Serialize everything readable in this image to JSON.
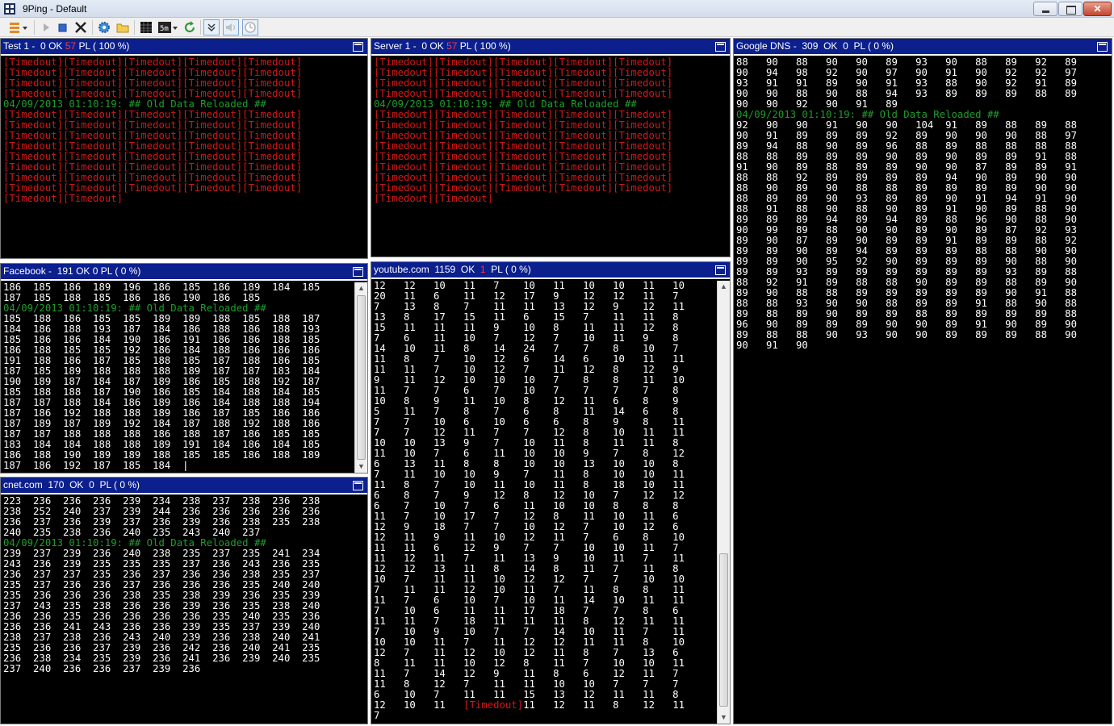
{
  "window": {
    "title": "9Ping - Default"
  },
  "toolbar": {
    "buttons": [
      "menu-icon",
      "play-icon",
      "stop-icon",
      "delete-icon",
      "settings-icon",
      "folder-icon",
      "grid-icon",
      "interval-icon",
      "refresh-icon",
      "collapse-icon",
      "sound-icon",
      "clock-icon"
    ]
  },
  "colors": {
    "panel_header": "#0b1f8d",
    "ok_text": "#ffffff",
    "timeout": "#d01818",
    "reloaded": "#1e9c2c",
    "background": "#000000"
  },
  "panels": {
    "test1": {
      "name": "Test 1 -",
      "ok_count": "0",
      "ok_label": "OK",
      "fail_count": "57",
      "pl_label": "PL ( 100 %)",
      "lines": [
        {
          "type": "to",
          "text": "[Timedout][Timedout][Timedout][Timedout][Timedout]"
        },
        {
          "type": "to",
          "text": "[Timedout][Timedout][Timedout][Timedout][Timedout]"
        },
        {
          "type": "to",
          "text": "[Timedout][Timedout][Timedout][Timedout][Timedout]"
        },
        {
          "type": "to",
          "text": "[Timedout][Timedout][Timedout][Timedout][Timedout]"
        },
        {
          "type": "green",
          "text": "04/09/2013 01:10:19: ## Old Data Reloaded ##"
        },
        {
          "type": "to",
          "text": "[Timedout][Timedout][Timedout][Timedout][Timedout]"
        },
        {
          "type": "to",
          "text": "[Timedout][Timedout][Timedout][Timedout][Timedout]"
        },
        {
          "type": "to",
          "text": "[Timedout][Timedout][Timedout][Timedout][Timedout]"
        },
        {
          "type": "to",
          "text": "[Timedout][Timedout][Timedout][Timedout][Timedout]"
        },
        {
          "type": "to",
          "text": "[Timedout][Timedout][Timedout][Timedout][Timedout]"
        },
        {
          "type": "to",
          "text": "[Timedout][Timedout][Timedout][Timedout][Timedout]"
        },
        {
          "type": "to",
          "text": "[Timedout][Timedout][Timedout][Timedout][Timedout]"
        },
        {
          "type": "to",
          "text": "[Timedout][Timedout][Timedout][Timedout][Timedout]"
        },
        {
          "type": "to",
          "text": "[Timedout][Timedout]"
        }
      ]
    },
    "server1": {
      "name": "Server 1 -",
      "ok_count": "0",
      "ok_label": "OK",
      "fail_count": "57",
      "pl_label": "PL ( 100 %)",
      "lines": [
        {
          "type": "to",
          "text": "[Timedout][Timedout][Timedout][Timedout][Timedout]"
        },
        {
          "type": "to",
          "text": "[Timedout][Timedout][Timedout][Timedout][Timedout]"
        },
        {
          "type": "to",
          "text": "[Timedout][Timedout][Timedout][Timedout][Timedout]"
        },
        {
          "type": "to",
          "text": "[Timedout][Timedout][Timedout][Timedout][Timedout]"
        },
        {
          "type": "green",
          "text": "04/09/2013 01:10:19: ## Old Data Reloaded ##"
        },
        {
          "type": "to",
          "text": "[Timedout][Timedout][Timedout][Timedout][Timedout]"
        },
        {
          "type": "to",
          "text": "[Timedout][Timedout][Timedout][Timedout][Timedout]"
        },
        {
          "type": "to",
          "text": "[Timedout][Timedout][Timedout][Timedout][Timedout]"
        },
        {
          "type": "to",
          "text": "[Timedout][Timedout][Timedout][Timedout][Timedout]"
        },
        {
          "type": "to",
          "text": "[Timedout][Timedout][Timedout][Timedout][Timedout]"
        },
        {
          "type": "to",
          "text": "[Timedout][Timedout][Timedout][Timedout][Timedout]"
        },
        {
          "type": "to",
          "text": "[Timedout][Timedout][Timedout][Timedout][Timedout]"
        },
        {
          "type": "to",
          "text": "[Timedout][Timedout][Timedout][Timedout][Timedout]"
        },
        {
          "type": "to",
          "text": "[Timedout][Timedout]"
        }
      ]
    },
    "google": {
      "name": "Google DNS -",
      "ok_count": "309",
      "ok_label": "OK",
      "fail_count": "0",
      "pl_label": "PL ( 0 %)",
      "lines": [
        {
          "type": "num",
          "text": "88   90   88   90   90   89   93   90   88   89   92   89"
        },
        {
          "type": "num",
          "text": "90   94   98   92   90   97   90   91   90   92   92   97"
        },
        {
          "type": "num",
          "text": "93   91   91   89   90   91   93   88   90   92   91   89"
        },
        {
          "type": "num",
          "text": "90   90   88   90   88   94   93   89   89   89   88   89"
        },
        {
          "type": "num",
          "text": "90   90   92   90   91   89"
        },
        {
          "type": "green",
          "text": "04/09/2013 01:10:19: ## Old Data Reloaded ##"
        },
        {
          "type": "num",
          "text": "92   90   90   91   90   90   104  91   89   88   89   88"
        },
        {
          "type": "num",
          "text": "90   91   89   89   89   92   89   90   90   90   88   97"
        },
        {
          "type": "num",
          "text": "89   94   88   90   89   96   88   89   88   88   88   88"
        },
        {
          "type": "num",
          "text": "88   88   89   89   89   90   89   90   89   89   91   88"
        },
        {
          "type": "num",
          "text": "91   90   89   88   89   89   90   90   87   89   89   91"
        },
        {
          "type": "num",
          "text": "88   88   92   89   89   89   89   94   90   89   90   90"
        },
        {
          "type": "num",
          "text": "88   90   89   90   88   88   89   89   89   89   90   90"
        },
        {
          "type": "num",
          "text": "88   89   89   90   93   89   89   90   91   94   91   90"
        },
        {
          "type": "num",
          "text": "88   91   88   90   88   90   89   91   90   89   88   90"
        },
        {
          "type": "num",
          "text": "89   89   89   94   89   94   89   88   96   90   88   90"
        },
        {
          "type": "num",
          "text": "90   99   89   88   90   90   89   90   89   87   92   93"
        },
        {
          "type": "num",
          "text": "89   90   87   89   90   89   89   91   89   89   88   92"
        },
        {
          "type": "num",
          "text": "89   89   90   89   94   89   89   89   88   88   90   90"
        },
        {
          "type": "num",
          "text": "89   89   90   95   92   90   89   89   89   90   88   90"
        },
        {
          "type": "num",
          "text": "89   89   93   89   89   89   89   89   89   93   89   88"
        },
        {
          "type": "num",
          "text": "88   92   91   89   88   88   90   89   89   88   89   90"
        },
        {
          "type": "num",
          "text": "89   90   88   88   89   89   89   89   89   90   91   88"
        },
        {
          "type": "num",
          "text": "88   88   93   90   90   88   89   89   91   88   90   88"
        },
        {
          "type": "num",
          "text": "89   88   89   90   89   89   88   89   89   89   89   88"
        },
        {
          "type": "num",
          "text": "96   90   89   89   89   90   90   89   91   90   89   90"
        },
        {
          "type": "num",
          "text": "89   88   88   90   93   90   90   89   89   89   88   90"
        },
        {
          "type": "num",
          "text": "90   91   90"
        }
      ]
    },
    "facebook": {
      "name": "Facebook -",
      "ok_count": "191",
      "ok_label": "OK",
      "fail_count": "0",
      "pl_label": "PL ( 0 %)",
      "lines": [
        {
          "type": "num",
          "text": "186  185  186  189  196  186  185  186  189  184  185"
        },
        {
          "type": "num",
          "text": "187  185  188  185  186  186  190  186  185"
        },
        {
          "type": "green",
          "text": "04/09/2013 01:10:19: ## Old Data Reloaded ##"
        },
        {
          "type": "num",
          "text": "185  188  186  185  185  189  189  188  185  188  187"
        },
        {
          "type": "num",
          "text": "184  186  188  193  187  184  186  188  186  188  193"
        },
        {
          "type": "num",
          "text": "185  186  186  184  190  186  191  186  186  188  185"
        },
        {
          "type": "num",
          "text": "186  188  185  185  192  186  184  188  186  186  186"
        },
        {
          "type": "num",
          "text": "191  188  186  187  185  188  185  187  188  186  185"
        },
        {
          "type": "num",
          "text": "187  185  189  188  188  188  189  187  187  183  184"
        },
        {
          "type": "num",
          "text": "190  189  187  184  187  189  186  185  188  192  187"
        },
        {
          "type": "num",
          "text": "185  188  188  187  190  186  185  184  188  184  185"
        },
        {
          "type": "num",
          "text": "187  187  188  184  186  189  186  184  188  188  194"
        },
        {
          "type": "num",
          "text": "187  186  192  188  188  189  186  187  185  186  186"
        },
        {
          "type": "num",
          "text": "187  189  187  189  192  184  187  188  192  188  186"
        },
        {
          "type": "num",
          "text": "187  187  188  188  188  186  188  187  186  185  185"
        },
        {
          "type": "num",
          "text": "183  184  184  188  188  189  191  184  186  184  185"
        },
        {
          "type": "num",
          "text": "186  188  190  189  189  188  185  185  186  188  189"
        },
        {
          "type": "num",
          "text": "187  186  192  187  185  184  |"
        }
      ]
    },
    "youtube": {
      "name": "youtube.com",
      "ok_count": "1159",
      "ok_label": "OK",
      "fail_count": "1",
      "pl_label": "PL ( 0 %)",
      "lines": [
        {
          "type": "num",
          "text": "12   12   10   11   7    10   11   10   10   11   10"
        },
        {
          "type": "num",
          "text": "20   11   6    11   12   17   9    12   12   11   7"
        },
        {
          "type": "num",
          "text": "7    13   8    7    11   11   13   12   9    12   11"
        },
        {
          "type": "num",
          "text": "13   8    17   15   11   6    15   7    11   11   8"
        },
        {
          "type": "num",
          "text": "15   11   11   11   9    10   8    11   11   12   8"
        },
        {
          "type": "num",
          "text": "7    6    11   10   7    12   7    10   11   9    8"
        },
        {
          "type": "num",
          "text": "14   10   11   8    14   24   7    7    8    10   7"
        },
        {
          "type": "num",
          "text": "11   8    7    10   12   6    14   6    10   11   11"
        },
        {
          "type": "num",
          "text": "11   11   7    10   12   7    11   12   8    12   9"
        },
        {
          "type": "num",
          "text": "9    11   12   10   10   10   7    8    8    11   10"
        },
        {
          "type": "num",
          "text": "11   7    7    6    7    10   7    7    7    7    8"
        },
        {
          "type": "num",
          "text": "10   8    9    11   10   8    12   11   6    8    9"
        },
        {
          "type": "num",
          "text": "5    11   7    8    7    6    8    11   14   6    8"
        },
        {
          "type": "num",
          "text": "7    7    10   6    10   6    6    8    9    8    11"
        },
        {
          "type": "num",
          "text": "7    7    12   11   7    7    12   8    10   11   11"
        },
        {
          "type": "num",
          "text": "10   10   13   9    7    10   11   8    11   11   8"
        },
        {
          "type": "num",
          "text": "11   10   7    6    11   10   10   9    7    8    12"
        },
        {
          "type": "num",
          "text": "6    13   11   8    8    10   10   13   10   10   8"
        },
        {
          "type": "num",
          "text": "7    11   10   10   9    7    11   8    10   10   11"
        },
        {
          "type": "num",
          "text": "11   8    7    10   11   10   11   8    18   10   11"
        },
        {
          "type": "num",
          "text": "6    8    7    9    12   8    12   10   7    12   12"
        },
        {
          "type": "num",
          "text": "6    7    10   7    6    11   10   10   8    8    8"
        },
        {
          "type": "num",
          "text": "11   7    10   17   7    12   8    11   10   11   6"
        },
        {
          "type": "num",
          "text": "12   9    18   7    7    10   12   7    10   12   6"
        },
        {
          "type": "num",
          "text": "12   11   9    11   10   12   11   7    6    8    10"
        },
        {
          "type": "num",
          "text": "11   11   6    12   9    7    7    10   10   11   7"
        },
        {
          "type": "num",
          "text": "11   12   11   7    11   13   9    10   11   7    11"
        },
        {
          "type": "num",
          "text": "12   12   13   11   8    14   8    11   7    11   8"
        },
        {
          "type": "num",
          "text": "10   7    11   11   10   12   12   7    7    10   10"
        },
        {
          "type": "num",
          "text": "7    11   11   12   10   11   7    11   8    8    11"
        },
        {
          "type": "num",
          "text": "11   7    6    10   7    10   11   14   10   11   11"
        },
        {
          "type": "num",
          "text": "7    10   6    11   11   17   18   7    7    8    6"
        },
        {
          "type": "num",
          "text": "11   11   7    18   11   11   11   8    12   11   11"
        },
        {
          "type": "num",
          "text": "7    10   9    10   7    7    14   10   11   7    11"
        },
        {
          "type": "num",
          "text": "10   10   11   7    11   12   12   11   11   8    10"
        },
        {
          "type": "num",
          "text": "12   7    11   12   10   12   11   8    7    13   6"
        },
        {
          "type": "num",
          "text": "8    11   11   10   12   8    11   7    10   10   11"
        },
        {
          "type": "num",
          "text": "11   7    14   12   9    11   8    6    12   11   7"
        },
        {
          "type": "num",
          "text": "11   8    12   7    11   11   10   10   7    7    7"
        },
        {
          "type": "num",
          "text": "6    10   7    11   11   15   13   12   11   11   8"
        },
        {
          "type": "mixed",
          "before": "12   10   11   ",
          "timeout": "[Timedout]",
          "after": "11   12   11   8    12   11"
        },
        {
          "type": "num",
          "text": "7"
        }
      ]
    },
    "cnet": {
      "name": "cnet.com",
      "ok_count": "170",
      "ok_label": "OK",
      "fail_count": "0",
      "pl_label": "PL ( 0 %)",
      "lines": [
        {
          "type": "num",
          "text": "223  236  236  236  239  234  238  237  238  236  238"
        },
        {
          "type": "num",
          "text": "238  252  240  237  239  244  236  236  236  236  236"
        },
        {
          "type": "num",
          "text": "236  237  236  239  237  236  239  236  238  235  238"
        },
        {
          "type": "num",
          "text": "240  235  238  236  240  235  243  240  237"
        },
        {
          "type": "green",
          "text": "04/09/2013 01:10:19: ## Old Data Reloaded ##"
        },
        {
          "type": "num",
          "text": "239  237  239  236  240  238  235  237  235  241  234"
        },
        {
          "type": "num",
          "text": "243  236  239  235  235  235  237  236  243  236  235"
        },
        {
          "type": "num",
          "text": "236  237  237  235  236  237  236  236  238  235  237"
        },
        {
          "type": "num",
          "text": "235  237  236  236  237  236  236  236  235  240  240"
        },
        {
          "type": "num",
          "text": "235  236  236  236  238  235  238  239  236  235  239"
        },
        {
          "type": "num",
          "text": "237  243  235  238  236  236  239  236  235  238  240"
        },
        {
          "type": "num",
          "text": "236  236  235  236  236  236  236  235  240  235  236"
        },
        {
          "type": "num",
          "text": "236  236  241  243  236  236  239  235  237  239  240"
        },
        {
          "type": "num",
          "text": "238  237  238  236  243  240  239  236  238  240  241"
        },
        {
          "type": "num",
          "text": "235  236  236  237  239  236  242  236  240  241  235"
        },
        {
          "type": "num",
          "text": "236  238  234  235  239  236  241  236  239  240  235"
        },
        {
          "type": "num",
          "text": "237  240  236  236  237  239  236"
        }
      ]
    }
  }
}
